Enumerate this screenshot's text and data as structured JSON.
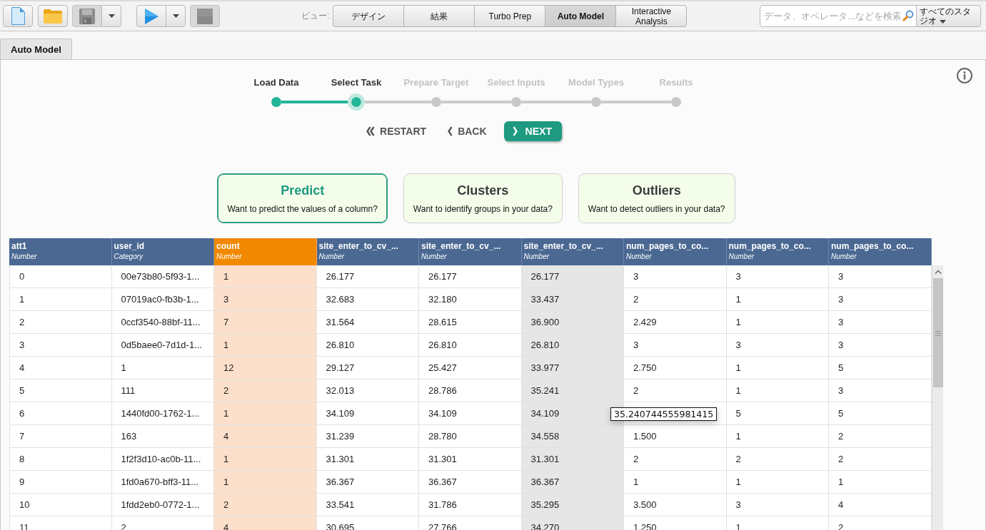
{
  "toolbar": {
    "buttons": [
      {
        "kind": "new",
        "disabled": false
      },
      {
        "kind": "open",
        "disabled": false
      },
      {
        "kind": "save",
        "disabled": true,
        "menu": true
      },
      {
        "kind": "run",
        "disabled": false,
        "menu": true
      },
      {
        "kind": "stop",
        "disabled": true
      }
    ]
  },
  "view_switcher": {
    "label": "ビュー:",
    "views": [
      {
        "label": "デザイン",
        "selected": false
      },
      {
        "label": "結果",
        "selected": false
      },
      {
        "label": "Turbo Prep",
        "selected": false
      },
      {
        "label": "Auto Model",
        "selected": true
      },
      {
        "label": "Interactive Analysis",
        "selected": false
      }
    ]
  },
  "search": {
    "placeholder": "データ、オペレータ...などを検索"
  },
  "scope": {
    "label": "すべてのスタジオ"
  },
  "tabs": [
    {
      "label": "Auto Model",
      "selected": true
    }
  ],
  "stepper": {
    "steps": [
      {
        "label": "Load Data",
        "completed": true,
        "selected": false
      },
      {
        "label": "Select Task",
        "completed": false,
        "selected": true
      },
      {
        "label": "Prepare Target",
        "completed": false,
        "selected": false
      },
      {
        "label": "Select Inputs",
        "completed": false,
        "selected": false
      },
      {
        "label": "Model Types",
        "completed": false,
        "selected": false
      },
      {
        "label": "Results",
        "completed": false,
        "selected": false
      }
    ]
  },
  "nav_buttons": [
    {
      "kind": "restart",
      "label": "RESTART"
    },
    {
      "kind": "back",
      "label": "BACK"
    },
    {
      "kind": "next",
      "label": "NEXT"
    }
  ],
  "tasks": [
    {
      "title": "Predict",
      "description": "Want to predict the values of a column?",
      "selected": true
    },
    {
      "title": "Clusters",
      "description": "Want to identify groups in your data?",
      "selected": false
    },
    {
      "title": "Outliers",
      "description": "Want to detect outliers in your data?",
      "selected": false
    }
  ],
  "table": {
    "columns": [
      {
        "name": "att1",
        "type": "Number",
        "selected": false,
        "highlighted": false
      },
      {
        "name": "user_id",
        "type": "Category",
        "selected": false,
        "highlighted": false
      },
      {
        "name": "count",
        "type": "Number",
        "selected": true,
        "highlighted": false
      },
      {
        "name": "site_enter_to_cv_...",
        "type": "Number",
        "selected": false,
        "highlighted": false
      },
      {
        "name": "site_enter_to_cv_...",
        "type": "Number",
        "selected": false,
        "highlighted": false
      },
      {
        "name": "site_enter_to_cv_...",
        "type": "Number",
        "selected": false,
        "highlighted": true
      },
      {
        "name": "num_pages_to_co...",
        "type": "Number",
        "selected": false,
        "highlighted": false
      },
      {
        "name": "num_pages_to_co...",
        "type": "Number",
        "selected": false,
        "highlighted": false
      },
      {
        "name": "num_pages_to_co...",
        "type": "Number",
        "selected": false,
        "highlighted": false
      }
    ],
    "rows": [
      [
        "0",
        "00e73b80-5f93-1...",
        "1",
        "26.177",
        "26.177",
        "26.177",
        "3",
        "3",
        "3"
      ],
      [
        "1",
        "07019ac0-fb3b-1...",
        "3",
        "32.683",
        "32.180",
        "33.437",
        "2",
        "1",
        "3"
      ],
      [
        "2",
        "0ccf3540-88bf-11...",
        "7",
        "31.564",
        "28.615",
        "36.900",
        "2.429",
        "1",
        "3"
      ],
      [
        "3",
        "0d5baee0-7d1d-1...",
        "1",
        "26.810",
        "26.810",
        "26.810",
        "3",
        "3",
        "3"
      ],
      [
        "4",
        "1",
        "12",
        "29.127",
        "25.427",
        "33.977",
        "2.750",
        "1",
        "5"
      ],
      [
        "5",
        "111",
        "2",
        "32.013",
        "28.786",
        "35.241",
        "2",
        "1",
        "3"
      ],
      [
        "6",
        "1440fd00-1762-1...",
        "1",
        "34.109",
        "34.109",
        "34.109",
        null,
        "5",
        "5"
      ],
      [
        "7",
        "163",
        "4",
        "31.239",
        "28.780",
        "34.558",
        "1.500",
        "1",
        "2"
      ],
      [
        "8",
        "1f2f3d10-ac0b-11...",
        "1",
        "31.301",
        "31.301",
        "31.301",
        "2",
        "2",
        "2"
      ],
      [
        "9",
        "1fd0a670-bff3-11...",
        "1",
        "36.367",
        "36.367",
        "36.367",
        "1",
        "1",
        "1"
      ],
      [
        "10",
        "1fdd2eb0-0772-1...",
        "2",
        "33.541",
        "31.786",
        "35.295",
        "3.500",
        "3",
        "4"
      ],
      [
        "11",
        "2",
        "4",
        "30.695",
        "27.766",
        "34.270",
        "1.250",
        "1",
        "2"
      ]
    ]
  },
  "tooltip": {
    "text": "35.240744555981415"
  }
}
